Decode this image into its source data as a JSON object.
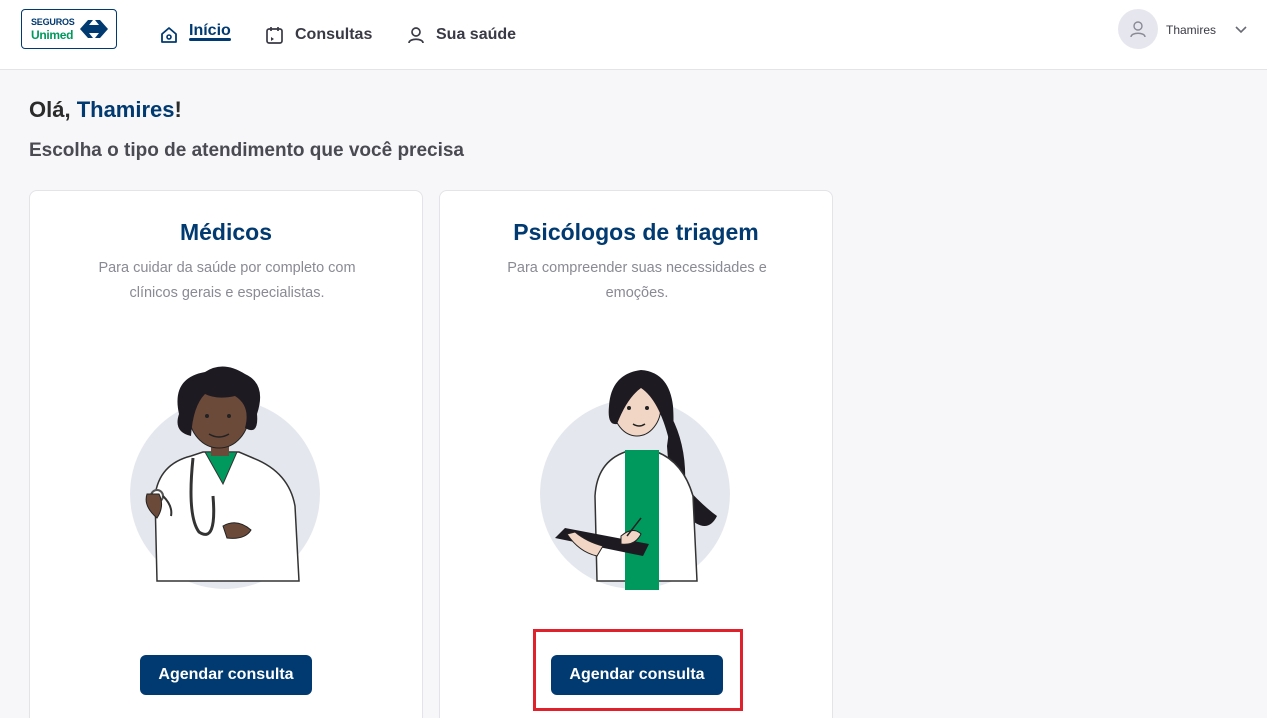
{
  "header": {
    "logo": {
      "line1": "SEGUROS",
      "line2": "Unimed"
    },
    "nav": [
      {
        "label": "Início",
        "icon": "home-icon",
        "active": true
      },
      {
        "label": "Consultas",
        "icon": "calendar-icon",
        "active": false
      },
      {
        "label": "Sua saúde",
        "icon": "user-icon",
        "active": false
      }
    ],
    "user": {
      "name": "Thamires",
      "icon": "user-avatar-icon"
    }
  },
  "main": {
    "greeting_prefix": "Olá, ",
    "greeting_name": "Thamires",
    "greeting_suffix": "!",
    "subtitle": "Escolha o tipo de atendimento que você precisa",
    "cards": [
      {
        "title": "Médicos",
        "description": "Para cuidar da saúde por completo com clínicos gerais e especialistas.",
        "button_label": "Agendar consulta"
      },
      {
        "title": "Psicólogos de triagem",
        "description": "Para compreender suas necessidades e emoções.",
        "button_label": "Agendar consulta"
      }
    ]
  },
  "colors": {
    "brand": "#003a70",
    "green": "#00995d",
    "highlight": "#e0202a",
    "background": "#f7f7f9"
  }
}
